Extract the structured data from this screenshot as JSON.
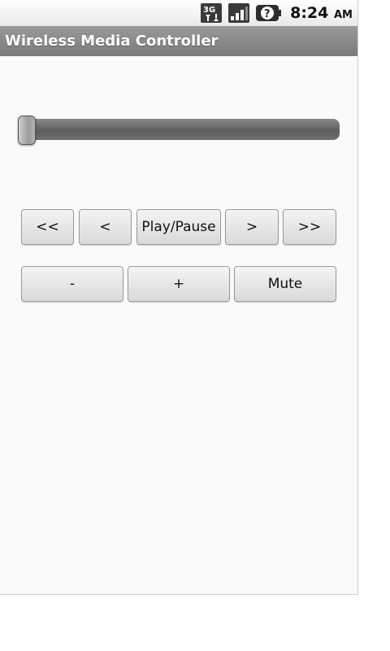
{
  "status_bar": {
    "network_icon": "3g-icon",
    "signal_icon": "signal-strength-icon",
    "battery_icon": "battery-unknown-icon",
    "time": "8:24",
    "ampm": "AM"
  },
  "title_bar": {
    "title": "Wireless Media Controller"
  },
  "seekbar": {
    "progress": 0.0
  },
  "transport": {
    "rewind_fast": "<<",
    "rewind": "<",
    "play_pause": "Play/Pause",
    "forward": ">",
    "forward_fast": ">>"
  },
  "volume": {
    "down": "-",
    "up": "+",
    "mute": "Mute"
  }
}
